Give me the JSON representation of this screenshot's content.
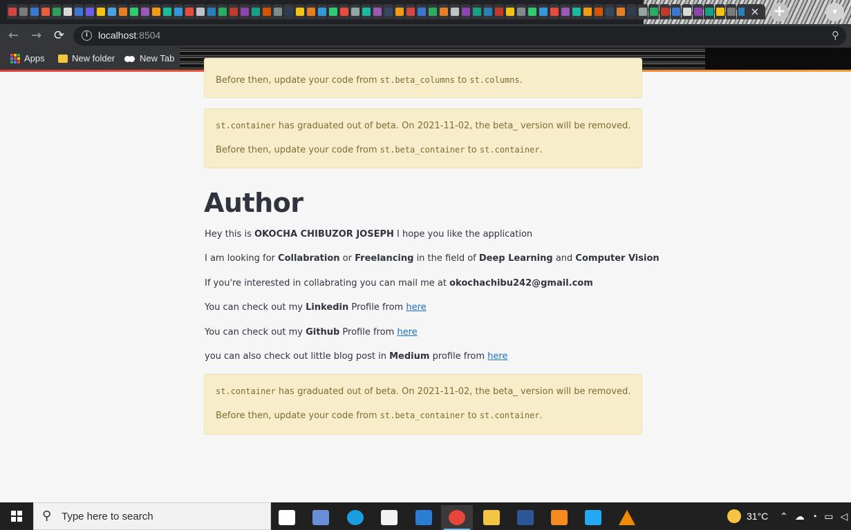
{
  "browser": {
    "favicon_tab_colors": [
      "#d64541",
      "#7a7a7a",
      "#3b76d1",
      "#e85d3a",
      "#2f9e5b",
      "#d9d9d9",
      "#3b76d1",
      "#6c5ce7",
      "#f1c40f",
      "#4aa3df",
      "#e67e22",
      "#2ecc71",
      "#9b59b6",
      "#f39c12",
      "#1abc9c",
      "#3498db",
      "#e74c3c",
      "#bdc3c7",
      "#2980b9",
      "#27ae60",
      "#c0392b",
      "#8e44ad",
      "#16a085",
      "#d35400",
      "#7f8c8d",
      "#2c3e50",
      "#f1c40f",
      "#e67e22",
      "#3498db",
      "#2ecc71",
      "#e74c3c",
      "#95a5a6",
      "#1abc9c",
      "#9b59b6",
      "#34495e",
      "#f39c12",
      "#d64541",
      "#3b76d1",
      "#27ae60",
      "#e67e22",
      "#bdc3c7",
      "#8e44ad",
      "#16a085",
      "#2980b9",
      "#c0392b",
      "#f1c40f",
      "#7f8c8d",
      "#2ecc71",
      "#3498db",
      "#e74c3c",
      "#9b59b6",
      "#1abc9c",
      "#f39c12",
      "#d35400",
      "#34495e",
      "#e67e22",
      "#2c3e50",
      "#95a5a6",
      "#27ae60",
      "#c0392b",
      "#3b76d1",
      "#d9d9d9",
      "#8e44ad",
      "#16a085",
      "#f1c40f",
      "#7a7a7a",
      "#2980b9"
    ],
    "close_tab_label": "×",
    "new_tab_label": "+",
    "url_host": "localhost",
    "url_port": ":8504",
    "bookmarks": {
      "apps": "Apps",
      "folder": "New folder",
      "newtab": "New Tab"
    }
  },
  "page": {
    "alert_top_partial": {
      "before": "Before then, update your code from ",
      "code1": "st.beta_columns",
      "mid": " to ",
      "code2": "st.columns",
      "end": "."
    },
    "alert_middle": {
      "code0": "st.container",
      "line1_rest": " has graduated out of beta. On 2021-11-02, the beta_ version will be removed.",
      "before": "Before then, update your code from ",
      "code1": "st.beta_container",
      "mid": " to ",
      "code2": "st.container",
      "end": "."
    },
    "heading": "Author",
    "paragraphs": {
      "p1_a": "Hey this is ",
      "p1_b": "OKOCHA CHIBUZOR JOSEPH",
      "p1_c": " I hope you like the application",
      "p2_a": "I am looking for ",
      "p2_b": "Collabration",
      "p2_c": " or ",
      "p2_d": "Freelancing",
      "p2_e": " in the field of ",
      "p2_f": "Deep Learning",
      "p2_g": " and ",
      "p2_h": "Computer Vision",
      "p3_a": "If you're interested in collabrating you can mail me at ",
      "p3_b": "okochachibu242@gmail.com",
      "p4_a": "You can check out my ",
      "p4_b": "Linkedin",
      "p4_c": " Profile from ",
      "p4_link": "here",
      "p5_a": "You can check out my ",
      "p5_b": "Github",
      "p5_c": " Profile from ",
      "p5_link": "here",
      "p6_a": "you can also check out little blog post in ",
      "p6_b": "Medium",
      "p6_c": " profile from ",
      "p6_link": "here"
    },
    "alert_bottom": {
      "code0": "st.container",
      "line1_rest": " has graduated out of beta. On 2021-11-02, the beta_ version will be removed.",
      "before": "Before then, update your code from ",
      "code1": "st.beta_container",
      "mid": " to ",
      "code2": "st.container",
      "end": "."
    }
  },
  "taskbar": {
    "search_placeholder": "Type here to search",
    "weather_temp": "31°C",
    "apps": [
      {
        "name": "task-view",
        "color": "#ffffff"
      },
      {
        "name": "network-app",
        "color": "#6a8fd8"
      },
      {
        "name": "edge",
        "color": "#1b9de2"
      },
      {
        "name": "store",
        "color": "#f2f2f2"
      },
      {
        "name": "mail",
        "color": "#2b7cd3"
      },
      {
        "name": "chrome",
        "color": "#e8453c"
      },
      {
        "name": "file-explorer",
        "color": "#f4c542"
      },
      {
        "name": "word",
        "color": "#2b5797"
      },
      {
        "name": "pdf",
        "color": "#f58a1f"
      },
      {
        "name": "vscode",
        "color": "#23a9f2"
      },
      {
        "name": "vlc",
        "color": "#f08a00"
      }
    ]
  }
}
